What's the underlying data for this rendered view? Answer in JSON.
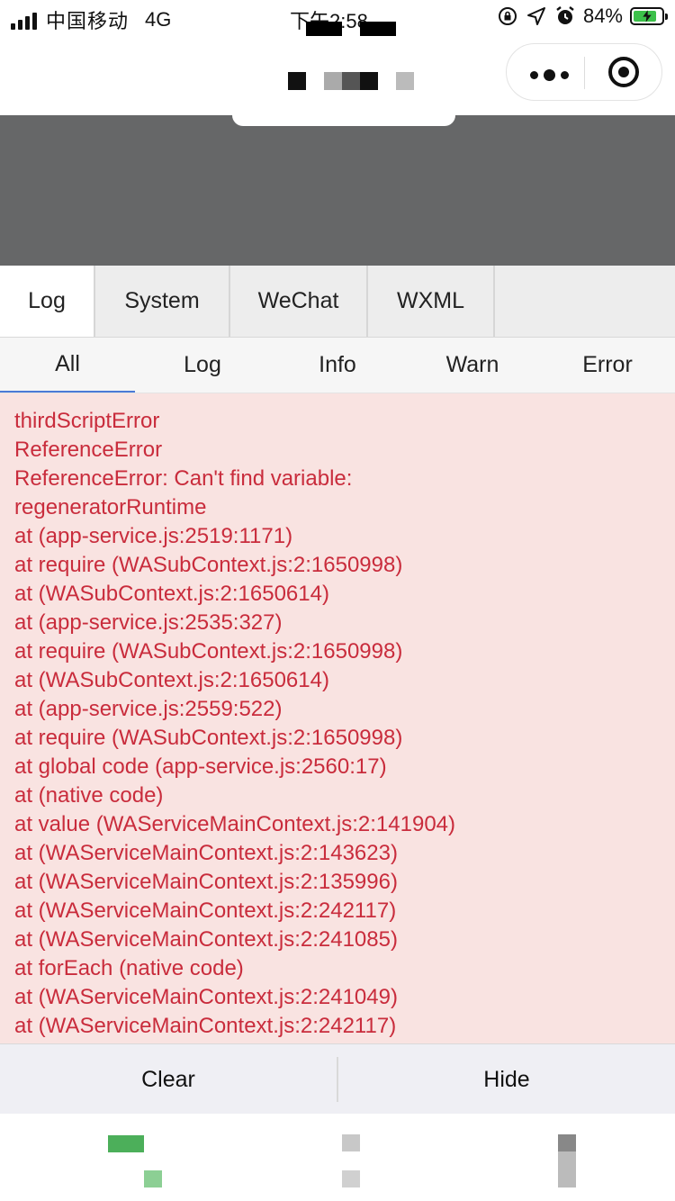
{
  "status_bar": {
    "carrier": "中国移动",
    "network": "4G",
    "time": "下午2:58",
    "battery_percent": "84%",
    "battery_level": 0.84,
    "icons": [
      "signal-icon",
      "screen-rotation-lock-icon",
      "location-icon",
      "alarm-icon",
      "battery-charging-icon"
    ]
  },
  "nav_bar": {
    "capsule_icons": [
      "more-icon",
      "close-miniprogram-icon"
    ]
  },
  "console": {
    "tabs": [
      {
        "label": "Log",
        "active": true
      },
      {
        "label": "System",
        "active": false
      },
      {
        "label": "WeChat",
        "active": false
      },
      {
        "label": "WXML",
        "active": false
      }
    ],
    "filters": [
      {
        "label": "All",
        "active": true
      },
      {
        "label": "Log",
        "active": false
      },
      {
        "label": "Info",
        "active": false
      },
      {
        "label": "Warn",
        "active": false
      },
      {
        "label": "Error",
        "active": false
      }
    ],
    "log_lines": [
      "thirdScriptError",
      "ReferenceError",
      "ReferenceError: Can't find variable:",
      "regeneratorRuntime",
      "at (app-service.js:2519:1171)",
      "at require (WASubContext.js:2:1650998)",
      "at (WASubContext.js:2:1650614)",
      "at (app-service.js:2535:327)",
      "at require (WASubContext.js:2:1650998)",
      "at (WASubContext.js:2:1650614)",
      "at (app-service.js:2559:522)",
      "at require (WASubContext.js:2:1650998)",
      "at global code (app-service.js:2560:17)",
      "at (native code)",
      "at value (WAServiceMainContext.js:2:141904)",
      "at (WAServiceMainContext.js:2:143623)",
      "at (WAServiceMainContext.js:2:135996)",
      "at (WAServiceMainContext.js:2:242117)",
      "at (WAServiceMainContext.js:2:241085)",
      "at forEach (native code)",
      "at (WAServiceMainContext.js:2:241049)",
      "at (WAServiceMainContext.js:2:242117)"
    ],
    "clear_label": "Clear",
    "hide_label": "Hide",
    "colors": {
      "error_text": "#c92c3c",
      "error_bg": "#f9e3e1",
      "active_filter": "#4b7ad6"
    }
  }
}
